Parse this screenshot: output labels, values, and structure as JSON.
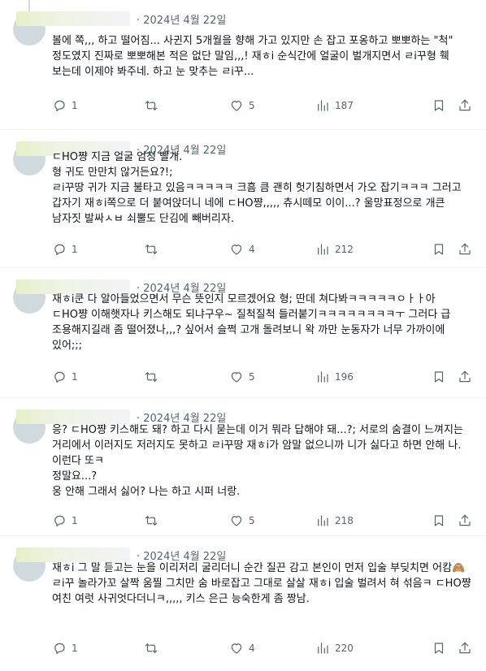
{
  "tweets": [
    {
      "date": "· 2024년 4월 22일",
      "text": "볼에 쪽,,, 하고 떨어짐... 사귄지 5개월을 향해 가고 있지만 손 잡고 포옹하고 뽀뽀하는 \"척\" 정도였지 진짜로 뽀뽀해본 적은 없단 말임,,,! 재ㅎi 순식간에 얼굴이 벌개지면서 ㄹi꾸형 훽 보는데 이제야 봐주네. 하고 눈 맞추는 ㄹi꾸...",
      "replies": "1",
      "retweets": "",
      "likes": "5",
      "views": "187"
    },
    {
      "date": "· 2024년 4월 22일",
      "text": "ㄷHO쨩 지금 얼굴 엄청 빨개.\n형 귀도 만만치 않거든요?!;\nㄹi꾸땅 귀가 지금 불타고 있음ㅋㅋㅋㅋㅋ 크흠 큼 괜히 헛기침하면서 가오 잡기ㅋㅋㅋ 그러고 갑자기 재ㅎi쪽으로 더 붙여앉더니 네에 ㄷHO쨩,,,,, 츄시떼모 이이...? 울망표정으로 개큰 남자짓 발싸ㅅㅂ 쇠뿔도 단김에 빼버리자.",
      "replies": "1",
      "retweets": "",
      "likes": "4",
      "views": "212"
    },
    {
      "date": "· 2024년 4월 22일",
      "text": "재ㅎi쿤 다 알아들었으면서 무슨 뜻인지 모르겠어요 형; 딴데 쳐다봐ㅋㅋㅋㅋㅋㅇㅏㅏ아 ㄷHO쨩 이해햇자나 키스해도 되냐구우~ 질척질척 들러붙기ㅋㅋㅋㅋㅋㅋㅋㅋㅜ 그러다 급 조용해지길래 좀 떨어졌나,,,? 싶어서 슬쩍 고개 돌려보니 왁 까만 눈동자가 너무 가까이에 있어;;;",
      "replies": "1",
      "retweets": "",
      "likes": "5",
      "views": "196"
    },
    {
      "date": "· 2024년 4월 22일",
      "text": "응? ㄷHO쨩 키스해도 돼? 하고 다시 묻는데 이거 뭐라 답해야 돼...?; 서로의 숨결이 느껴지는 거리에서 이러지도 저러지도 못하고 ㄹi꾸땅 재ㅎi가 암말 없으니까 니가 싫다고 하면 안해 나. 이런다 또ㅋ\n정말요...?\n웅 안해 그래서 싫어? 나는 하고 시퍼 너랑.",
      "replies": "1",
      "retweets": "",
      "likes": "5",
      "views": "218"
    },
    {
      "date": "· 2024년 4월 22일",
      "text": "재ㅎi 그 말 듣고는 눈을 이리저리 굴리더니 순간 질끈 감고 본인이 먼저 입술 부딪치면 어캄🙈 ㄹi꾸 놀라가꼬 살짝 움찔 그치만 숨 바로잡고 그대로 살살 재ㅎi 입술 벌려서 혀 섞음ㅋ ㄷHO쨩 여친 여럿 사귀엇다더니ㅋ,,,,, 키스 은근 능숙한게 좀 짱남.",
      "replies": "1",
      "retweets": "",
      "likes": "4",
      "views": "220"
    }
  ],
  "icons": {
    "reply": "reply-icon",
    "retweet": "retweet-icon",
    "like": "heart-icon",
    "views": "views-icon",
    "bookmark": "bookmark-icon",
    "share": "share-icon"
  }
}
